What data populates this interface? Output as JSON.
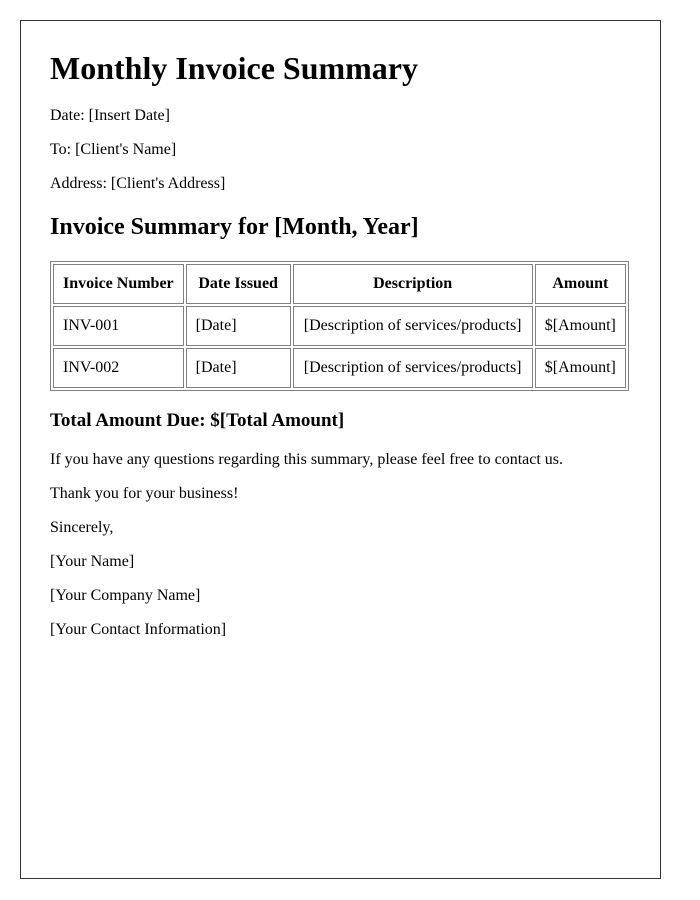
{
  "document": {
    "title": "Monthly Invoice Summary",
    "date_line": "Date: [Insert Date]",
    "to_line": "To: [Client's Name]",
    "address_line": "Address: [Client's Address]",
    "section_heading": "Invoice Summary for [Month, Year]"
  },
  "table": {
    "headers": [
      "Invoice Number",
      "Date Issued",
      "Description",
      "Amount"
    ],
    "rows": [
      [
        "INV-001",
        "[Date]",
        "[Description of services/products]",
        "$[Amount]"
      ],
      [
        "INV-002",
        "[Date]",
        "[Description of services/products]",
        "$[Amount]"
      ]
    ]
  },
  "total_line": "Total Amount Due: $[Total Amount]",
  "closing": {
    "questions": "If you have any questions regarding this summary, please feel free to contact us.",
    "thanks": "Thank you for your business!",
    "sign_off": "Sincerely,",
    "your_name": "[Your Name]",
    "company_name": "[Your Company Name]",
    "contact_info": "[Your Contact Information]"
  }
}
